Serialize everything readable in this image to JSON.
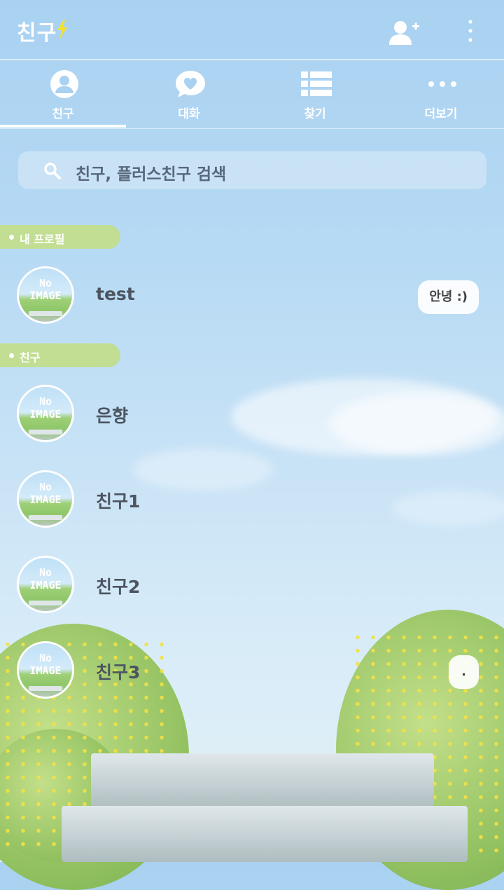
{
  "header": {
    "title": "친구"
  },
  "tabs": [
    {
      "label": "친구",
      "icon": "person-icon",
      "active": true
    },
    {
      "label": "대화",
      "icon": "chat-heart-icon",
      "active": false
    },
    {
      "label": "찾기",
      "icon": "list-icon",
      "active": false
    },
    {
      "label": "더보기",
      "icon": "more-dots-icon",
      "active": false
    }
  ],
  "search": {
    "placeholder": "친구, 플러스친구 검색"
  },
  "sections": {
    "my_profile": "내 프로필",
    "friends": "친구"
  },
  "my_profile": {
    "avatar_text": [
      "No",
      "IMAGE"
    ],
    "name": "test",
    "status": "안녕 :)"
  },
  "friends": [
    {
      "avatar_text": [
        "No",
        "IMAGE"
      ],
      "name": "은향",
      "status": ""
    },
    {
      "avatar_text": [
        "No",
        "IMAGE"
      ],
      "name": "친구1",
      "status": ""
    },
    {
      "avatar_text": [
        "No",
        "IMAGE"
      ],
      "name": "친구2",
      "status": ""
    },
    {
      "avatar_text": [
        "No",
        "IMAGE"
      ],
      "name": "친구3",
      "status": "."
    }
  ],
  "colors": {
    "accent_green": "#c1de93",
    "sky": "#a9d1f1",
    "bolt": "#f2e231"
  }
}
